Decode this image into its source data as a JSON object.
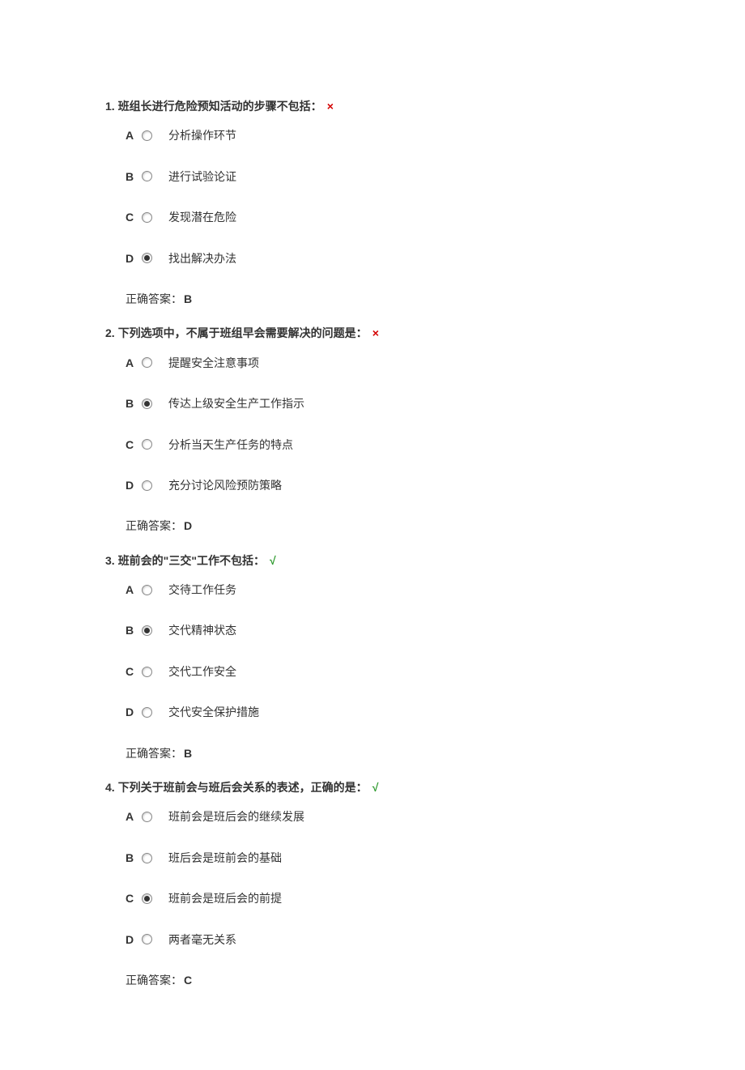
{
  "answer_label": "正确答案：",
  "marks": {
    "wrong": "×",
    "correct": "√"
  },
  "questions": [
    {
      "number": "1.",
      "text": "班组长进行危险预知活动的步骤不包括：",
      "result": "wrong",
      "options": [
        {
          "letter": "A",
          "text": "分析操作环节",
          "selected": false
        },
        {
          "letter": "B",
          "text": "进行试验论证",
          "selected": false
        },
        {
          "letter": "C",
          "text": "发现潜在危险",
          "selected": false
        },
        {
          "letter": "D",
          "text": "找出解决办法",
          "selected": true
        }
      ],
      "answer": "B"
    },
    {
      "number": "2.",
      "text": "下列选项中，不属于班组早会需要解决的问题是：",
      "result": "wrong",
      "options": [
        {
          "letter": "A",
          "text": "提醒安全注意事项",
          "selected": false
        },
        {
          "letter": "B",
          "text": "传达上级安全生产工作指示",
          "selected": true
        },
        {
          "letter": "C",
          "text": "分析当天生产任务的特点",
          "selected": false
        },
        {
          "letter": "D",
          "text": "充分讨论风险预防策略",
          "selected": false
        }
      ],
      "answer": "D"
    },
    {
      "number": "3.",
      "text": "班前会的\"三交\"工作不包括：",
      "result": "correct",
      "options": [
        {
          "letter": "A",
          "text": "交待工作任务",
          "selected": false
        },
        {
          "letter": "B",
          "text": "交代精神状态",
          "selected": true
        },
        {
          "letter": "C",
          "text": "交代工作安全",
          "selected": false
        },
        {
          "letter": "D",
          "text": "交代安全保护措施",
          "selected": false
        }
      ],
      "answer": "B"
    },
    {
      "number": "4.",
      "text": "下列关于班前会与班后会关系的表述，正确的是：",
      "result": "correct",
      "options": [
        {
          "letter": "A",
          "text": "班前会是班后会的继续发展",
          "selected": false
        },
        {
          "letter": "B",
          "text": "班后会是班前会的基础",
          "selected": false
        },
        {
          "letter": "C",
          "text": "班前会是班后会的前提",
          "selected": true
        },
        {
          "letter": "D",
          "text": "两者毫无关系",
          "selected": false
        }
      ],
      "answer": "C"
    }
  ]
}
